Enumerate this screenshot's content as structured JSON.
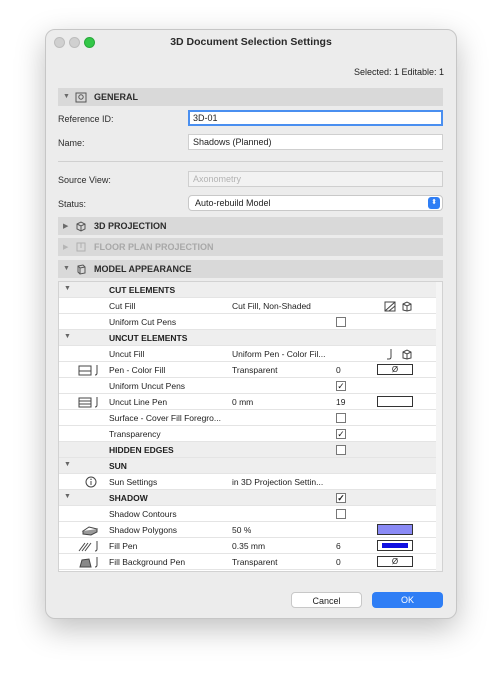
{
  "window": {
    "title": "3D Document Selection Settings"
  },
  "status": "Selected: 1 Editable: 1",
  "sections": {
    "general": "GENERAL",
    "projection": "3D PROJECTION",
    "floorplan": "FLOOR PLAN PROJECTION",
    "appearance": "MODEL APPEARANCE"
  },
  "fields": {
    "reference_label": "Reference ID:",
    "reference_value": "3D-01",
    "name_label": "Name:",
    "name_value": "Shadows (Planned)",
    "source_label": "Source View:",
    "source_value": "Axonometry",
    "status_label": "Status:",
    "status_value": "Auto-rebuild Model"
  },
  "rows": {
    "cut_elements": "CUT ELEMENTS",
    "cut_fill": {
      "name": "Cut Fill",
      "value": "Cut Fill, Non-Shaded"
    },
    "uniform_cut_pens": {
      "name": "Uniform Cut Pens",
      "checked": false
    },
    "uncut_elements": "UNCUT ELEMENTS",
    "uncut_fill": {
      "name": "Uncut Fill",
      "value": "Uniform Pen - Color Fil..."
    },
    "pen_color_fill": {
      "name": "Pen - Color Fill",
      "value": "Transparent",
      "num": "0",
      "swatch": "Ø"
    },
    "uniform_uncut_pens": {
      "name": "Uniform Uncut Pens",
      "checked": true
    },
    "uncut_line_pen": {
      "name": "Uncut Line Pen",
      "value": "0 mm",
      "num": "19"
    },
    "surface_cover": {
      "name": "Surface - Cover Fill Foregro...",
      "checked": false
    },
    "transparency": {
      "name": "Transparency",
      "checked": true
    },
    "hidden_edges": {
      "name": "HIDDEN EDGES",
      "checked": false
    },
    "sun": "SUN",
    "sun_settings": {
      "name": "Sun Settings",
      "value": "in 3D Projection Settin..."
    },
    "shadow": {
      "name": "SHADOW",
      "checked": true
    },
    "shadow_contours": {
      "name": "Shadow Contours",
      "checked": false
    },
    "shadow_polygons": {
      "name": "Shadow Polygons",
      "value": "50 %",
      "color": "#8a8af5"
    },
    "fill_pen": {
      "name": "Fill Pen",
      "value": "0.35 mm",
      "num": "6",
      "color": "#1010e0"
    },
    "fill_bg_pen": {
      "name": "Fill Background Pen",
      "value": "Transparent",
      "num": "0",
      "swatch": "Ø"
    }
  },
  "buttons": {
    "cancel": "Cancel",
    "ok": "OK"
  },
  "colors": {
    "accent": "#2f7ef5",
    "close_dot": "#33c748"
  }
}
